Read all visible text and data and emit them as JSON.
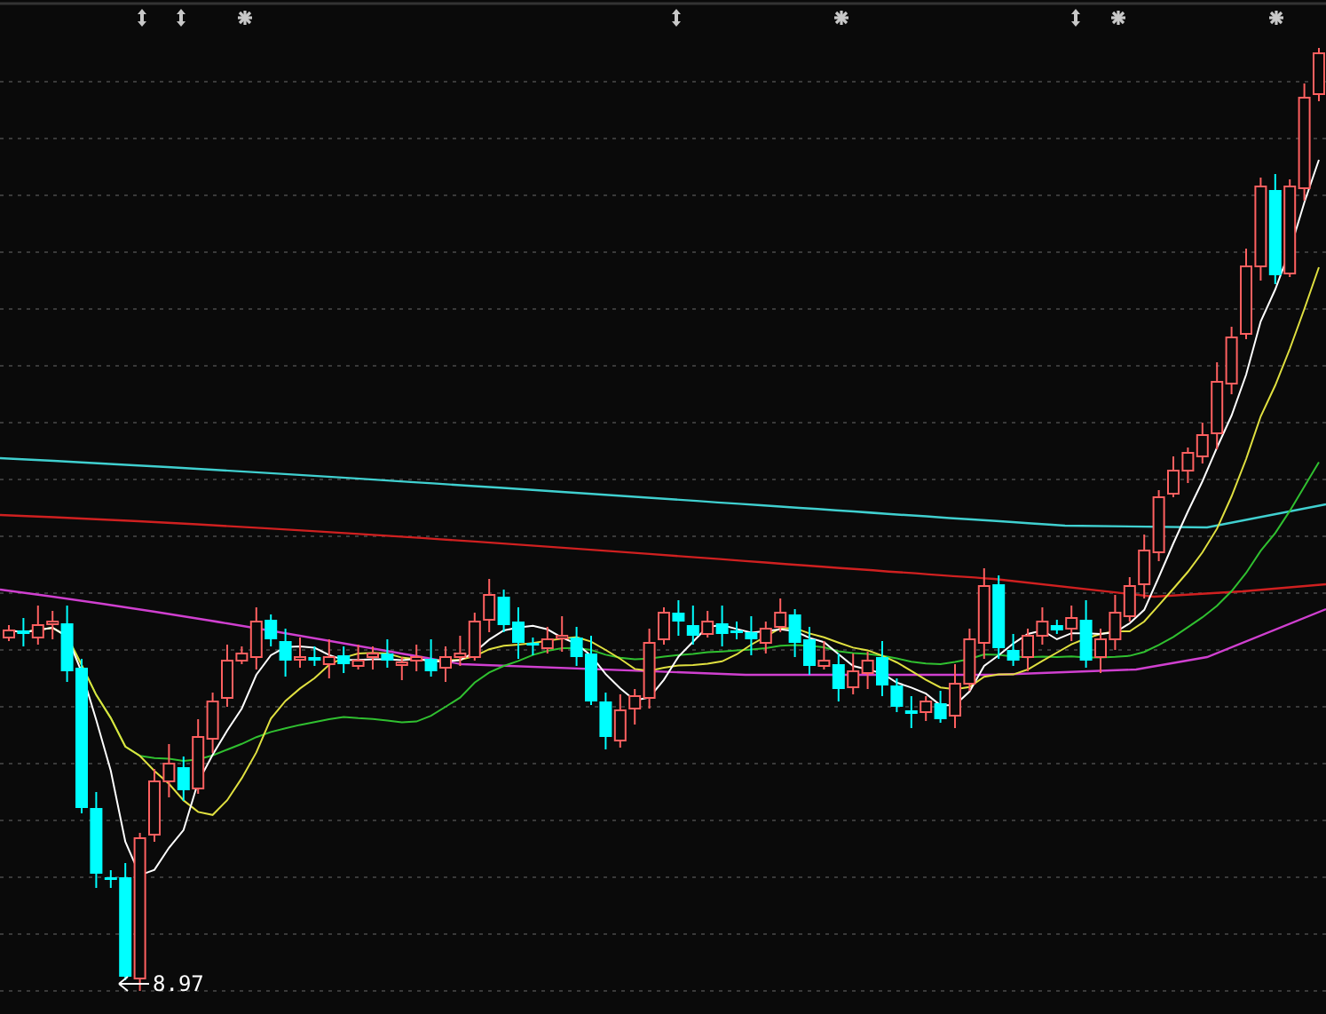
{
  "chart": {
    "markers": [
      {
        "kind": "updown"
      },
      {
        "kind": "updown"
      },
      {
        "kind": "star"
      },
      {
        "kind": "updown"
      },
      {
        "kind": "star"
      },
      {
        "kind": "updown"
      },
      {
        "kind": "star"
      },
      {
        "kind": "star"
      }
    ],
    "low_label": {
      "value": "8.97"
    }
  }
}
